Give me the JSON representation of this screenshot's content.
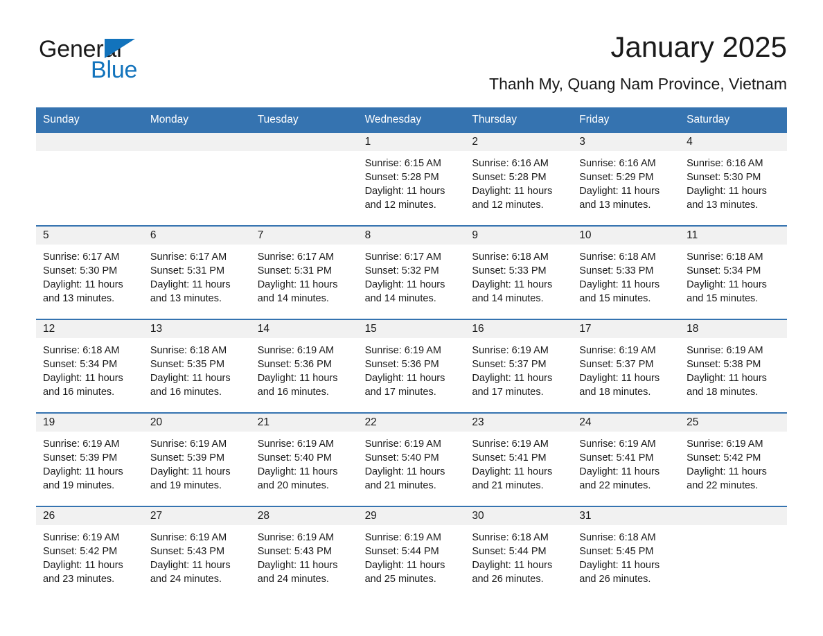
{
  "brand": {
    "name_part1": "General",
    "name_part2": "Blue",
    "triangle_icon": "blue-triangle-icon",
    "accent_color": "#1273BC"
  },
  "header": {
    "title": "January 2025",
    "subtitle": "Thanh My, Quang Nam Province, Vietnam",
    "header_bar_color": "#3573B0",
    "daynum_band_color": "#F1F1F1"
  },
  "calendar": {
    "weekday_headers": [
      "Sunday",
      "Monday",
      "Tuesday",
      "Wednesday",
      "Thursday",
      "Friday",
      "Saturday"
    ],
    "weeks": [
      [
        {
          "day": "",
          "lines": []
        },
        {
          "day": "",
          "lines": []
        },
        {
          "day": "",
          "lines": []
        },
        {
          "day": "1",
          "lines": [
            "Sunrise: 6:15 AM",
            "Sunset: 5:28 PM",
            "Daylight: 11 hours",
            "and 12 minutes."
          ]
        },
        {
          "day": "2",
          "lines": [
            "Sunrise: 6:16 AM",
            "Sunset: 5:28 PM",
            "Daylight: 11 hours",
            "and 12 minutes."
          ]
        },
        {
          "day": "3",
          "lines": [
            "Sunrise: 6:16 AM",
            "Sunset: 5:29 PM",
            "Daylight: 11 hours",
            "and 13 minutes."
          ]
        },
        {
          "day": "4",
          "lines": [
            "Sunrise: 6:16 AM",
            "Sunset: 5:30 PM",
            "Daylight: 11 hours",
            "and 13 minutes."
          ]
        }
      ],
      [
        {
          "day": "5",
          "lines": [
            "Sunrise: 6:17 AM",
            "Sunset: 5:30 PM",
            "Daylight: 11 hours",
            "and 13 minutes."
          ]
        },
        {
          "day": "6",
          "lines": [
            "Sunrise: 6:17 AM",
            "Sunset: 5:31 PM",
            "Daylight: 11 hours",
            "and 13 minutes."
          ]
        },
        {
          "day": "7",
          "lines": [
            "Sunrise: 6:17 AM",
            "Sunset: 5:31 PM",
            "Daylight: 11 hours",
            "and 14 minutes."
          ]
        },
        {
          "day": "8",
          "lines": [
            "Sunrise: 6:17 AM",
            "Sunset: 5:32 PM",
            "Daylight: 11 hours",
            "and 14 minutes."
          ]
        },
        {
          "day": "9",
          "lines": [
            "Sunrise: 6:18 AM",
            "Sunset: 5:33 PM",
            "Daylight: 11 hours",
            "and 14 minutes."
          ]
        },
        {
          "day": "10",
          "lines": [
            "Sunrise: 6:18 AM",
            "Sunset: 5:33 PM",
            "Daylight: 11 hours",
            "and 15 minutes."
          ]
        },
        {
          "day": "11",
          "lines": [
            "Sunrise: 6:18 AM",
            "Sunset: 5:34 PM",
            "Daylight: 11 hours",
            "and 15 minutes."
          ]
        }
      ],
      [
        {
          "day": "12",
          "lines": [
            "Sunrise: 6:18 AM",
            "Sunset: 5:34 PM",
            "Daylight: 11 hours",
            "and 16 minutes."
          ]
        },
        {
          "day": "13",
          "lines": [
            "Sunrise: 6:18 AM",
            "Sunset: 5:35 PM",
            "Daylight: 11 hours",
            "and 16 minutes."
          ]
        },
        {
          "day": "14",
          "lines": [
            "Sunrise: 6:19 AM",
            "Sunset: 5:36 PM",
            "Daylight: 11 hours",
            "and 16 minutes."
          ]
        },
        {
          "day": "15",
          "lines": [
            "Sunrise: 6:19 AM",
            "Sunset: 5:36 PM",
            "Daylight: 11 hours",
            "and 17 minutes."
          ]
        },
        {
          "day": "16",
          "lines": [
            "Sunrise: 6:19 AM",
            "Sunset: 5:37 PM",
            "Daylight: 11 hours",
            "and 17 minutes."
          ]
        },
        {
          "day": "17",
          "lines": [
            "Sunrise: 6:19 AM",
            "Sunset: 5:37 PM",
            "Daylight: 11 hours",
            "and 18 minutes."
          ]
        },
        {
          "day": "18",
          "lines": [
            "Sunrise: 6:19 AM",
            "Sunset: 5:38 PM",
            "Daylight: 11 hours",
            "and 18 minutes."
          ]
        }
      ],
      [
        {
          "day": "19",
          "lines": [
            "Sunrise: 6:19 AM",
            "Sunset: 5:39 PM",
            "Daylight: 11 hours",
            "and 19 minutes."
          ]
        },
        {
          "day": "20",
          "lines": [
            "Sunrise: 6:19 AM",
            "Sunset: 5:39 PM",
            "Daylight: 11 hours",
            "and 19 minutes."
          ]
        },
        {
          "day": "21",
          "lines": [
            "Sunrise: 6:19 AM",
            "Sunset: 5:40 PM",
            "Daylight: 11 hours",
            "and 20 minutes."
          ]
        },
        {
          "day": "22",
          "lines": [
            "Sunrise: 6:19 AM",
            "Sunset: 5:40 PM",
            "Daylight: 11 hours",
            "and 21 minutes."
          ]
        },
        {
          "day": "23",
          "lines": [
            "Sunrise: 6:19 AM",
            "Sunset: 5:41 PM",
            "Daylight: 11 hours",
            "and 21 minutes."
          ]
        },
        {
          "day": "24",
          "lines": [
            "Sunrise: 6:19 AM",
            "Sunset: 5:41 PM",
            "Daylight: 11 hours",
            "and 22 minutes."
          ]
        },
        {
          "day": "25",
          "lines": [
            "Sunrise: 6:19 AM",
            "Sunset: 5:42 PM",
            "Daylight: 11 hours",
            "and 22 minutes."
          ]
        }
      ],
      [
        {
          "day": "26",
          "lines": [
            "Sunrise: 6:19 AM",
            "Sunset: 5:42 PM",
            "Daylight: 11 hours",
            "and 23 minutes."
          ]
        },
        {
          "day": "27",
          "lines": [
            "Sunrise: 6:19 AM",
            "Sunset: 5:43 PM",
            "Daylight: 11 hours",
            "and 24 minutes."
          ]
        },
        {
          "day": "28",
          "lines": [
            "Sunrise: 6:19 AM",
            "Sunset: 5:43 PM",
            "Daylight: 11 hours",
            "and 24 minutes."
          ]
        },
        {
          "day": "29",
          "lines": [
            "Sunrise: 6:19 AM",
            "Sunset: 5:44 PM",
            "Daylight: 11 hours",
            "and 25 minutes."
          ]
        },
        {
          "day": "30",
          "lines": [
            "Sunrise: 6:18 AM",
            "Sunset: 5:44 PM",
            "Daylight: 11 hours",
            "and 26 minutes."
          ]
        },
        {
          "day": "31",
          "lines": [
            "Sunrise: 6:18 AM",
            "Sunset: 5:45 PM",
            "Daylight: 11 hours",
            "and 26 minutes."
          ]
        },
        {
          "day": "",
          "lines": []
        }
      ]
    ]
  }
}
